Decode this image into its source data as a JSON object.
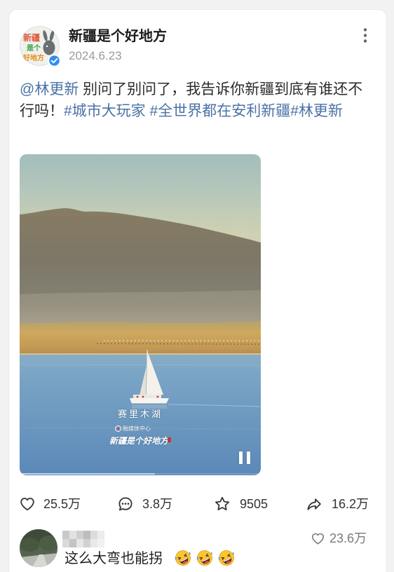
{
  "colors": {
    "page_background": "#f2f2f2",
    "card_background": "#ffffff",
    "link": "#4a72a6",
    "verified_badge": "#2f8cf0",
    "secondary_text": "#9b9b9b"
  },
  "post": {
    "author": {
      "name": "新疆是个好地方",
      "avatar_icon": "account-logo-avatar",
      "avatar_logo_lines": [
        "新疆",
        "是个",
        "好地方"
      ],
      "verified_icon": "verified-check-icon"
    },
    "date": "2024.6.23",
    "menu_icon": "more-vertical-icon",
    "content_segments": [
      {
        "type": "mention",
        "text": "@林更新"
      },
      {
        "type": "text",
        "text": " 别问了别问了，我告诉你新疆到底有谁还不行吗！"
      },
      {
        "type": "hashtag",
        "text": "#城市大玩家"
      },
      {
        "type": "text",
        "text": " "
      },
      {
        "type": "hashtag",
        "text": "#全世界都在安利新疆"
      },
      {
        "type": "hashtag",
        "text": "#林更新"
      }
    ],
    "video": {
      "caption": "赛里木湖",
      "watermark_org": "融媒体中心",
      "watermark_title": "新疆是个好地方",
      "control_icon": "pause-icon",
      "progress": 0.56
    },
    "actions": {
      "like": {
        "icon": "heart-outline-icon",
        "count": "25.5万"
      },
      "comment": {
        "icon": "comment-bubble-icon",
        "count": "3.8万"
      },
      "favorite": {
        "icon": "star-outline-icon",
        "count": "9505"
      },
      "share": {
        "icon": "share-arrow-icon",
        "count": "16.2万"
      }
    }
  },
  "top_comment": {
    "avatar_icon": "commenter-avatar-photo",
    "like_icon": "heart-outline-icon",
    "like_count": "23.6万",
    "text": "这么大弯也能拐",
    "emoji_icons": [
      "rolling-on-the-floor-laughing-emoji",
      "rolling-on-the-floor-laughing-emoji",
      "rolling-on-the-floor-laughing-emoji"
    ]
  }
}
